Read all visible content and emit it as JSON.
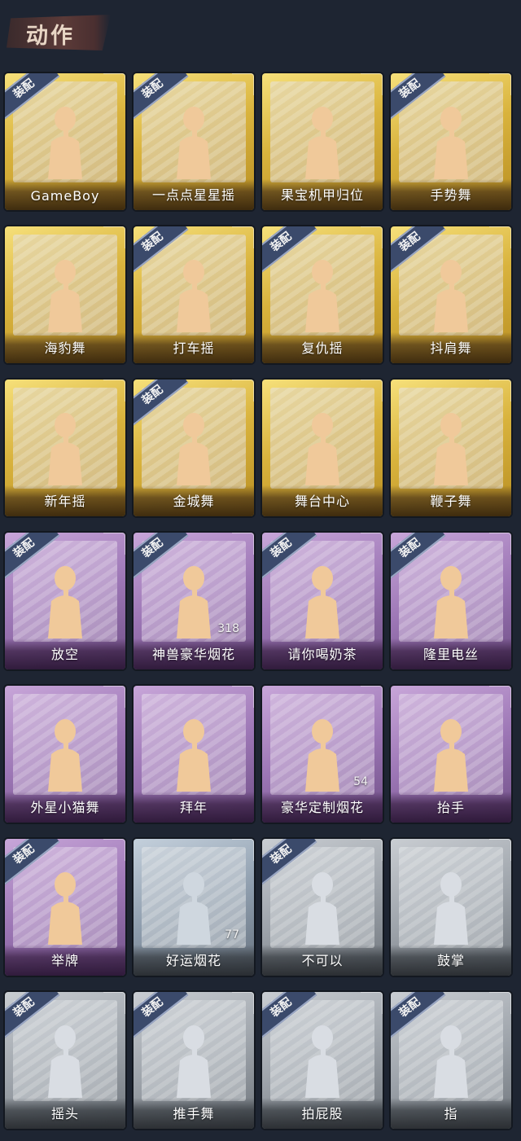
{
  "header": {
    "title": "动作"
  },
  "equip_label": "装配",
  "colors": {
    "gold": "#d9b33d",
    "purple": "#9c76b5",
    "gray": "#9ea4ab",
    "bluegray": "#8f9eae",
    "background": "#1e2532",
    "equip_tag": "#3b4a6b"
  },
  "items": [
    {
      "label": "GameBoy",
      "rarity": "gold",
      "equipped": true,
      "icon": "figure-game-icon",
      "count": ""
    },
    {
      "label": "一点点星星摇",
      "rarity": "gold",
      "equipped": true,
      "icon": "figure-star-icon",
      "count": ""
    },
    {
      "label": "果宝机甲归位",
      "rarity": "gold",
      "equipped": false,
      "icon": "figure-pose-icon",
      "count": ""
    },
    {
      "label": "手势舞",
      "rarity": "gold",
      "equipped": true,
      "icon": "figure-gesture-icon",
      "count": ""
    },
    {
      "label": "海豹舞",
      "rarity": "gold",
      "equipped": false,
      "icon": "figure-dance-icon",
      "count": ""
    },
    {
      "label": "打车摇",
      "rarity": "gold",
      "equipped": true,
      "icon": "figure-dance-icon",
      "count": ""
    },
    {
      "label": "复仇摇",
      "rarity": "gold",
      "equipped": true,
      "icon": "figure-raise-hand-icon",
      "count": ""
    },
    {
      "label": "抖肩舞",
      "rarity": "gold",
      "equipped": true,
      "icon": "figure-shoulder-icon",
      "count": ""
    },
    {
      "label": "新年摇",
      "rarity": "gold",
      "equipped": false,
      "icon": "figure-clap-icon",
      "count": ""
    },
    {
      "label": "金城舞",
      "rarity": "gold",
      "equipped": true,
      "icon": "figure-dance-icon",
      "count": ""
    },
    {
      "label": "舞台中心",
      "rarity": "gold",
      "equipped": false,
      "icon": "figure-point-icon",
      "count": ""
    },
    {
      "label": "鞭子舞",
      "rarity": "gold",
      "equipped": false,
      "icon": "figure-heart-icon",
      "count": ""
    },
    {
      "label": "放空",
      "rarity": "purple",
      "equipped": true,
      "icon": "figure-hood-icon",
      "count": ""
    },
    {
      "label": "神兽豪华烟花",
      "rarity": "purple",
      "equipped": true,
      "icon": "fireworks-icon",
      "count": "318"
    },
    {
      "label": "请你喝奶茶",
      "rarity": "purple",
      "equipped": true,
      "icon": "figure-sign-icon",
      "count": ""
    },
    {
      "label": "隆里电丝",
      "rarity": "purple",
      "equipped": true,
      "icon": "figure-point-icon",
      "count": ""
    },
    {
      "label": "外星小猫舞",
      "rarity": "purple",
      "equipped": false,
      "icon": "figure-lightning-icon",
      "count": ""
    },
    {
      "label": "拜年",
      "rarity": "purple",
      "equipped": false,
      "icon": "figure-bow-icon",
      "count": ""
    },
    {
      "label": "豪华定制烟花",
      "rarity": "purple",
      "equipped": false,
      "icon": "fireworks-icon",
      "count": "54"
    },
    {
      "label": "抬手",
      "rarity": "purple",
      "equipped": false,
      "icon": "figure-wave-icon",
      "count": ""
    },
    {
      "label": "举牌",
      "rarity": "purple",
      "equipped": true,
      "icon": "figure-placard-icon",
      "count": ""
    },
    {
      "label": "好运烟花",
      "rarity": "bluegray",
      "equipped": false,
      "icon": "firecracker-icon",
      "count": "77"
    },
    {
      "label": "不可以",
      "rarity": "gray",
      "equipped": true,
      "icon": "hand-no-icon",
      "count": ""
    },
    {
      "label": "鼓掌",
      "rarity": "gray",
      "equipped": false,
      "icon": "hand-clap-icon",
      "count": ""
    },
    {
      "label": "摇头",
      "rarity": "gray",
      "equipped": true,
      "icon": "figure-shake-icon",
      "count": ""
    },
    {
      "label": "推手舞",
      "rarity": "gray",
      "equipped": true,
      "icon": "figure-push-icon",
      "count": ""
    },
    {
      "label": "拍屁股",
      "rarity": "gray",
      "equipped": true,
      "icon": "figure-slap-icon",
      "count": ""
    },
    {
      "label": "指",
      "rarity": "gray",
      "equipped": true,
      "icon": "hand-point-icon",
      "count": ""
    }
  ]
}
